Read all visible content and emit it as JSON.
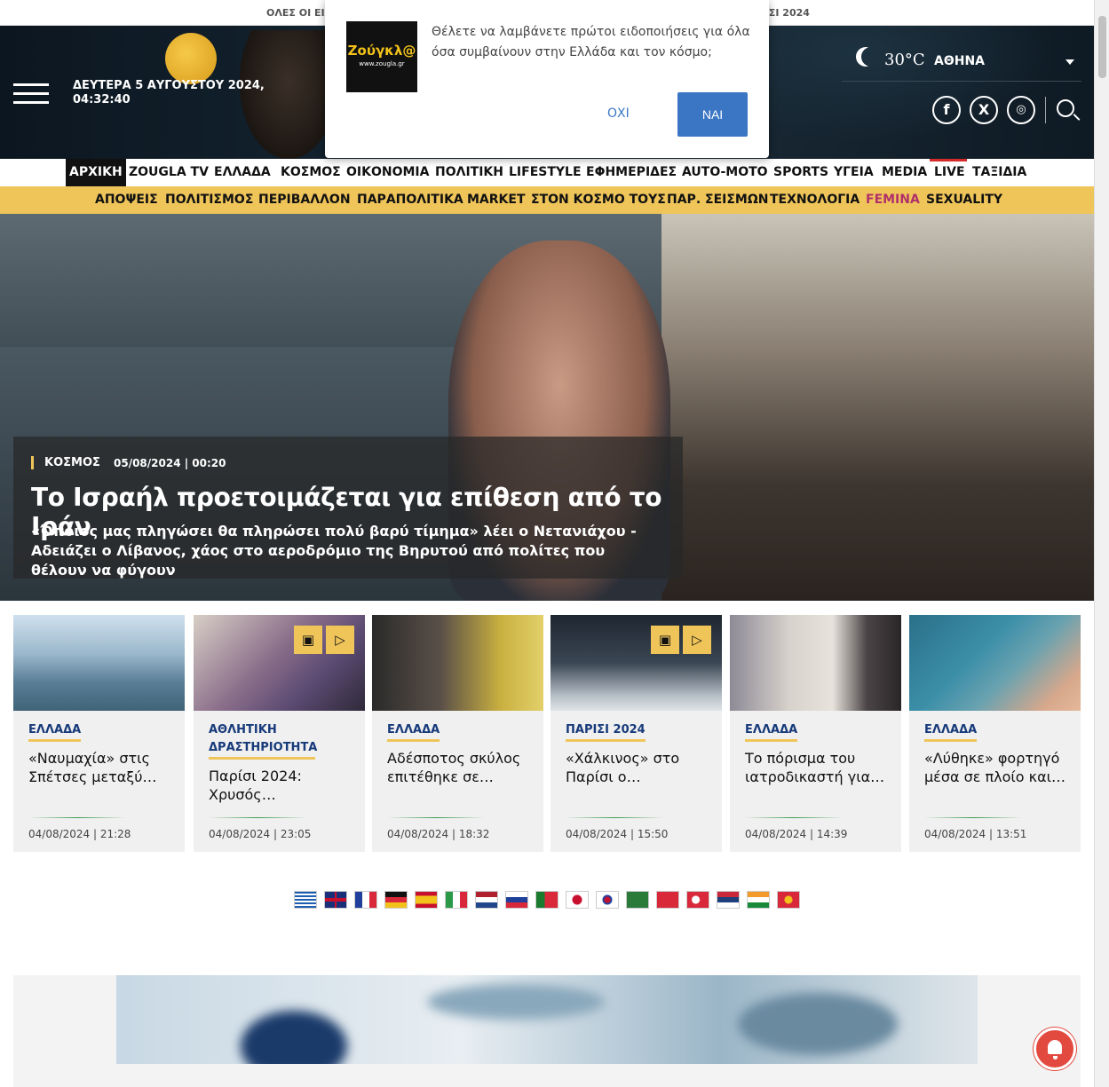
{
  "ticker": {
    "left": "ΟΛΕΣ ΟΙ ΕΙΔ",
    "right": "ΠΑΡΙΣΙ 2024"
  },
  "header": {
    "date": "ΔΕΥΤΕΡΑ 5 ΑΥΓΟΥΣΤΟΥ 2024,",
    "time": "04:32:40",
    "weather": {
      "temp": "30°C",
      "city": "ΑΘΗΝΑ"
    },
    "social": [
      "facebook-icon",
      "x-icon",
      "instagram-icon"
    ]
  },
  "popup": {
    "logo": "Ζούγκλ@",
    "logo_sub": "www.zougla.gr",
    "message": "Θέλετε να λαμβάνετε πρώτοι ειδοποιήσεις για όλα όσα συμβαίνουν στην Ελλάδα και τον κόσμο;",
    "no": "ΟΧΙ",
    "yes": "ΝΑΙ"
  },
  "nav_primary": [
    "ΑΡΧΙΚΗ",
    "ZOUGLA TV",
    "ΕΛΛΑΔΑ",
    "ΚΟΣΜΟΣ",
    "ΟΙΚΟΝΟΜΙΑ",
    "ΠΟΛΙΤΙΚΗ",
    "LIFESTYLE",
    "ΕΦΗΜΕΡΙΔΕΣ",
    "AUTO-MOTO",
    "SPORTS",
    "ΥΓΕΙΑ",
    "MEDIA",
    "LIVE",
    "ΤΑΞΙΔΙΑ"
  ],
  "nav_secondary": [
    "ΑΠΟΨΕΙΣ",
    "ΠΟΛΙΤΙΣΜΟΣ",
    "ΠΕΡΙΒΑΛΛΟΝ",
    "ΠΑΡΑΠΟΛΙΤΙΚΑ",
    "MARKET",
    "ΣΤΟΝ ΚΟΣΜΟ ΤΟΥΣ",
    "ΠΑΡ. ΣΕΙΣΜΩΝ",
    "ΤΕΧΝΟΛΟΓΙΑ",
    "FEMINA",
    "SEXUALITY"
  ],
  "hero": {
    "category": "ΚΟΣΜΟΣ",
    "date": "05/08/2024 | 00:20",
    "title": "Το Ισραήλ προετοιμάζεται για επίθεση από το Ιράν",
    "subtitle": "«Όποιος μας πληγώσει θα πληρώσει πολύ βαρύ τίμημα» λέει ο Νετανιάχου - Αδειάζει ο Λίβανος, χάος στο αεροδρόμιο της Βηρυτού από πολίτες που θέλουν να φύγουν"
  },
  "cards": [
    {
      "category": "ΕΛΛΑΔΑ",
      "title": "«Ναυμαχία» στις Σπέτσες μεταξύ…",
      "date": "04/08/2024 | 21:28"
    },
    {
      "category": "ΑΘΛΗΤΙΚΗ ΔΡΑΣΤΗΡΙΟΤΗΤΑ",
      "title": "Παρίσι 2024: Χρυσός…",
      "date": "04/08/2024 | 23:05"
    },
    {
      "category": "ΕΛΛΑΔΑ",
      "title": "Αδέσποτος σκύλος επιτέθηκε σε…",
      "date": "04/08/2024 | 18:32"
    },
    {
      "category": "ΠΑΡΙΣΙ 2024",
      "title": "«Χάλκινος» στο Παρίσι ο…",
      "date": "04/08/2024 | 15:50"
    },
    {
      "category": "ΕΛΛΑΔΑ",
      "title": "Το πόρισμα του ιατροδικαστή για…",
      "date": "04/08/2024 | 14:39"
    },
    {
      "category": "ΕΛΛΑΔΑ",
      "title": "«Λύθηκε» φορτηγό μέσα σε πλοίο και…",
      "date": "04/08/2024 | 13:51"
    }
  ],
  "flags": [
    "greece-flag",
    "uk-flag",
    "france-flag",
    "germany-flag",
    "spain-flag",
    "italy-flag",
    "netherlands-flag",
    "russia-flag",
    "portugal-flag",
    "japan-flag",
    "korea-flag",
    "saudi-flag",
    "china-flag",
    "turkey-flag",
    "serbia-flag",
    "india-flag",
    "vietnam-flag"
  ]
}
